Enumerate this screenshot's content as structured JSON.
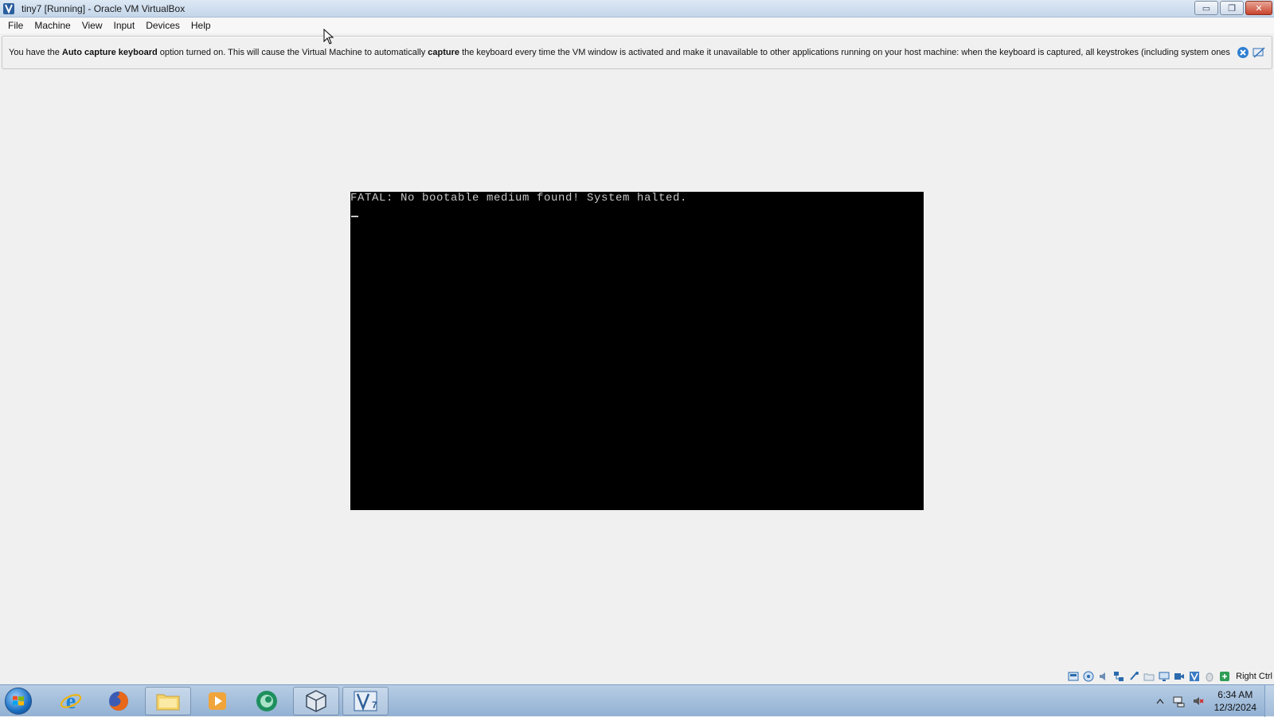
{
  "window": {
    "title": "tiny7 [Running] - Oracle VM VirtualBox",
    "controls": {
      "minimize": "▭",
      "restore": "❐",
      "close": "✕"
    }
  },
  "menu": {
    "items": [
      "File",
      "Machine",
      "View",
      "Input",
      "Devices",
      "Help"
    ]
  },
  "notice": {
    "part1": "You have the ",
    "bold1": "Auto capture keyboard",
    "part2": " option turned on. This will cause the Virtual Machine to automatically ",
    "bold2": "capture",
    "part3": " the keyboard every time the VM window is activated and make it unavailable to other applications running on your host machine: when the keyboard is captured, all keystrokes (including system ones",
    "icons": [
      "close-notice-icon",
      "do-not-show-again-icon"
    ]
  },
  "vm": {
    "screen_text": "FATAL: No bootable medium found! System halted.",
    "cursor": "_"
  },
  "statusbar": {
    "icons": [
      "hard-disk-icon",
      "optical-drive-icon",
      "audio-icon",
      "network-icon",
      "usb-icon",
      "shared-folders-icon",
      "display-icon",
      "video-capture-icon",
      "vt-x-icon",
      "mouse-integration-icon",
      "keyboard-capture-icon"
    ],
    "host_key": "Right Ctrl"
  },
  "taskbar": {
    "apps": [
      "internet-explorer-icon",
      "firefox-icon",
      "file-explorer-icon",
      "media-player-icon",
      "app-icon",
      "virtualbox-manager-icon",
      "virtualbox-vm-icon"
    ],
    "open_apps": [
      false,
      false,
      true,
      false,
      false,
      true,
      true
    ]
  },
  "clock": {
    "time": "6:34 AM",
    "date": "12/3/2024"
  },
  "colors": {
    "vm_background": "#000000",
    "vm_text": "#c8c8c8",
    "window_background": "#f0f0f0",
    "taskbar": "#a8c3e0"
  }
}
